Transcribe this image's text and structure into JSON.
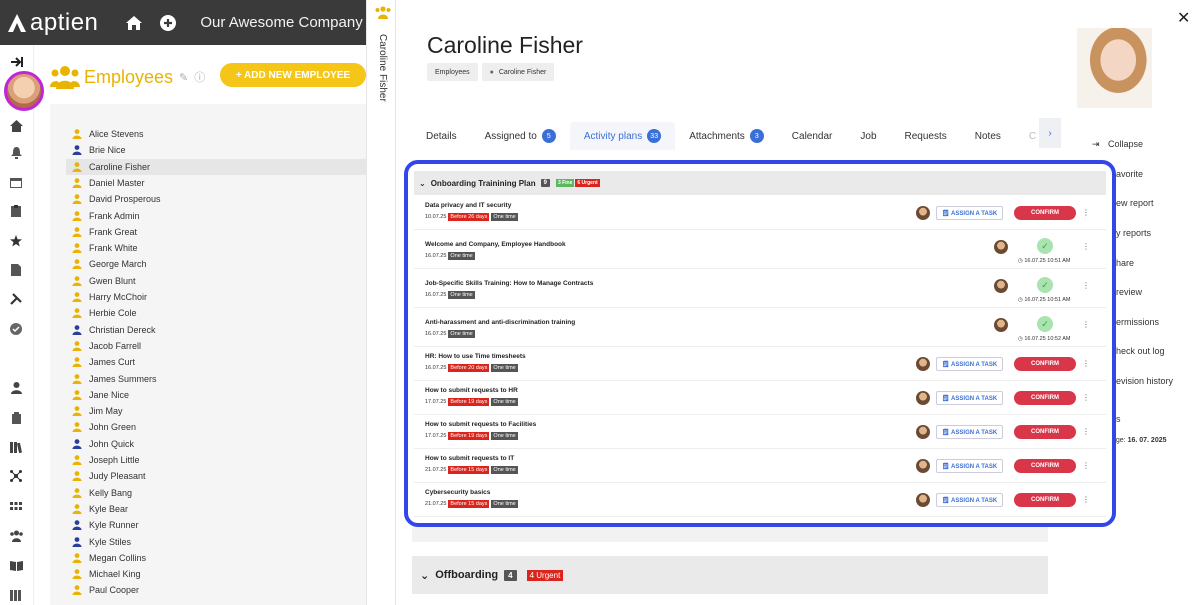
{
  "app": {
    "logo_text": "aptien",
    "company": "Our Awesome Company"
  },
  "employees_panel": {
    "title": "Employees",
    "add_button_label": "+ ADD NEW EMPLOYEE",
    "items": [
      {
        "name": "Alice Stevens",
        "color": "#e8b400"
      },
      {
        "name": "Brie Nice",
        "color": "#2a3f9b"
      },
      {
        "name": "Caroline Fisher",
        "color": "#e8b400",
        "selected": true
      },
      {
        "name": "Daniel Master",
        "color": "#e8b400"
      },
      {
        "name": "David Prosperous",
        "color": "#e8b400"
      },
      {
        "name": "Frank Admin",
        "color": "#e8b400"
      },
      {
        "name": "Frank Great",
        "color": "#e8b400"
      },
      {
        "name": "Frank White",
        "color": "#e8b400"
      },
      {
        "name": "George March",
        "color": "#e8b400"
      },
      {
        "name": "Gwen Blunt",
        "color": "#e8b400"
      },
      {
        "name": "Harry McChoir",
        "color": "#e8b400"
      },
      {
        "name": "Herbie Cole",
        "color": "#e8b400"
      },
      {
        "name": "Christian Dereck",
        "color": "#2a3f9b"
      },
      {
        "name": "Jacob Farrell",
        "color": "#e8b400"
      },
      {
        "name": "James Curt",
        "color": "#e8b400"
      },
      {
        "name": "James Summers",
        "color": "#e8b400"
      },
      {
        "name": "Jane Nice",
        "color": "#e8b400"
      },
      {
        "name": "Jim May",
        "color": "#e8b400"
      },
      {
        "name": "John Green",
        "color": "#e8b400"
      },
      {
        "name": "John Quick",
        "color": "#2a3f9b"
      },
      {
        "name": "Joseph Little",
        "color": "#e8b400"
      },
      {
        "name": "Judy Pleasant",
        "color": "#e8b400"
      },
      {
        "name": "Kelly Bang",
        "color": "#e8b400"
      },
      {
        "name": "Kyle Bear",
        "color": "#e8b400"
      },
      {
        "name": "Kyle Runner",
        "color": "#2a3f9b"
      },
      {
        "name": "Kyle Stiles",
        "color": "#2a3f9b"
      },
      {
        "name": "Megan Collins",
        "color": "#e8b400"
      },
      {
        "name": "Michael King",
        "color": "#e8b400"
      },
      {
        "name": "Paul Cooper",
        "color": "#e8b400"
      }
    ]
  },
  "vertical_tab": {
    "label": "Caroline Fisher"
  },
  "detail": {
    "name": "Caroline Fisher",
    "breadcrumbs": [
      "Employees",
      "Caroline Fisher"
    ],
    "tabs": [
      {
        "label": "Details"
      },
      {
        "label": "Assigned to",
        "badge": "5"
      },
      {
        "label": "Activity plans",
        "badge": "33",
        "active": true
      },
      {
        "label": "Attachments",
        "badge": "3"
      },
      {
        "label": "Calendar"
      },
      {
        "label": "Job"
      },
      {
        "label": "Requests"
      },
      {
        "label": "Notes"
      },
      {
        "label": "C"
      }
    ],
    "right_menu": [
      "Collapse",
      "avorite",
      "ew report",
      "y reports",
      "hare",
      "review",
      "ermissions",
      "heck out log",
      "evision history",
      "s"
    ],
    "right_meta": {
      "label": "nge:",
      "value": "16. 07. 2025"
    }
  },
  "plan": {
    "title": "Onboarding Trainining Plan",
    "count": "9",
    "fine": "3 Fine",
    "urgent": "6 Urgent",
    "assign_label": "ASSIGN A TASK",
    "confirm_label": "CONFIRM",
    "rows": [
      {
        "title": "Data privacy and IT security",
        "date": "10.07.25",
        "due": "Before 26 days",
        "freq": "One time",
        "done": false
      },
      {
        "title": "Welcome and Company, Employee Handbook",
        "date": "16.07.25",
        "freq": "One time",
        "done": true,
        "done_at": "16.07.25 10:51 AM"
      },
      {
        "title": "Job-Specific Skills Training: How to Manage Contracts",
        "date": "16.07.25",
        "freq": "One time",
        "done": true,
        "done_at": "16.07.25 10:51 AM"
      },
      {
        "title": "Anti-harassment and anti-discrimination training",
        "date": "16.07.25",
        "freq": "One time",
        "done": true,
        "done_at": "16.07.25 10:52 AM"
      },
      {
        "title": "HR: How to use Time timesheets",
        "date": "16.07.25",
        "due": "Before 20 days",
        "freq": "One time",
        "done": false
      },
      {
        "title": "How to submit requests to HR",
        "date": "17.07.25",
        "due": "Before 19 days",
        "freq": "One time",
        "done": false
      },
      {
        "title": "How to submit requests to Facilities",
        "date": "17.07.25",
        "due": "Before 19 days",
        "freq": "One time",
        "done": false
      },
      {
        "title": "How to submit requests to IT",
        "date": "21.07.25",
        "due": "Before 15 days",
        "freq": "One time",
        "done": false
      },
      {
        "title": "Cybersecurity basics",
        "date": "21.07.25",
        "due": "Before 15 days",
        "freq": "One time",
        "done": false
      }
    ]
  },
  "offboarding": {
    "title": "Offboarding",
    "count": "4",
    "urgent": "4 Urgent"
  }
}
